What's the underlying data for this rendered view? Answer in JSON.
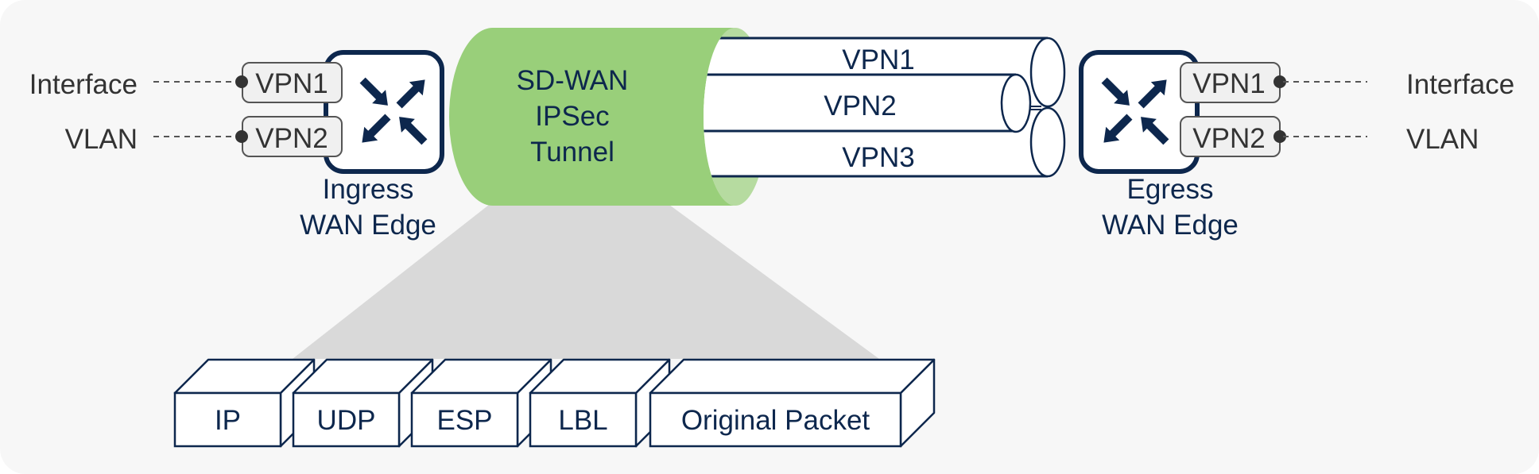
{
  "ingress": {
    "label_line1": "Ingress",
    "label_line2": "WAN Edge",
    "icon": "router-icon",
    "ports": [
      {
        "label": "VPN1",
        "connected_to": "Interface"
      },
      {
        "label": "VPN2",
        "connected_to": "VLAN"
      }
    ]
  },
  "egress": {
    "label_line1": "Egress",
    "label_line2": "WAN Edge",
    "icon": "router-icon",
    "ports": [
      {
        "label": "VPN1",
        "connected_to": "Interface"
      },
      {
        "label": "VPN2",
        "connected_to": "VLAN"
      }
    ]
  },
  "tunnel": {
    "line1": "SD-WAN",
    "line2": "IPSec",
    "line3": "Tunnel",
    "color": "#99cf7a",
    "end_color": "#b6dba0"
  },
  "vpn_pipes": [
    {
      "label": "VPN1"
    },
    {
      "label": "VPN2"
    },
    {
      "label": "VPN3"
    }
  ],
  "packet": {
    "fields": [
      {
        "label": "IP"
      },
      {
        "label": "UDP"
      },
      {
        "label": "ESP"
      },
      {
        "label": "LBL"
      },
      {
        "label": "Original Packet"
      }
    ]
  },
  "colors": {
    "navy": "#0d274d",
    "background": "#f7f7f7",
    "projection": "#d9d9d9",
    "port_fill": "#f0f0f0",
    "port_stroke": "#555555"
  }
}
